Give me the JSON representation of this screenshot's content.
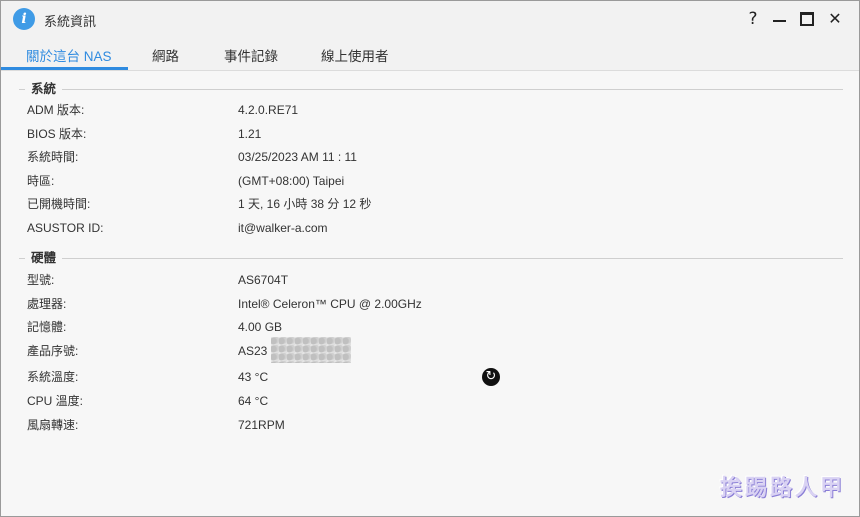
{
  "window": {
    "title": "系統資訊",
    "app_icon": "info-icon"
  },
  "controls": {
    "help": "?",
    "close": "✕"
  },
  "tabs": [
    {
      "label": "關於這台 NAS",
      "active": true
    },
    {
      "label": "網路",
      "active": false
    },
    {
      "label": "事件記錄",
      "active": false
    },
    {
      "label": "線上使用者",
      "active": false
    }
  ],
  "system": {
    "heading": "系統",
    "rows": [
      {
        "key": "ADM 版本:",
        "value": "4.2.0.RE71"
      },
      {
        "key": "BIOS 版本:",
        "value": "1.21"
      },
      {
        "key": "系統時間:",
        "value": "03/25/2023  AM 11 : 11"
      },
      {
        "key": "時區:",
        "value": "(GMT+08:00) Taipei"
      },
      {
        "key": "已開機時間:",
        "value": "1 天, 16 小時 38 分 12 秒"
      },
      {
        "key": "ASUSTOR ID:",
        "value": "it@walker-a.com"
      }
    ]
  },
  "hardware": {
    "heading": "硬體",
    "rows": [
      {
        "key": "型號:",
        "value": "AS6704T"
      },
      {
        "key": "處理器:",
        "value": "Intel® Celeron™ CPU @ 2.00GHz"
      },
      {
        "key": "記憶體:",
        "value": "4.00 GB"
      },
      {
        "key": "產品序號:",
        "value": "AS23"
      },
      {
        "key": "系統溫度:",
        "value": "43 °C"
      },
      {
        "key": "CPU 溫度:",
        "value": "64 °C"
      },
      {
        "key": "風扇轉速:",
        "value": "721RPM"
      }
    ]
  },
  "watermark": "挨踢路人甲",
  "colors": {
    "accent": "#2f8be0",
    "icon": "#3f9be6"
  }
}
